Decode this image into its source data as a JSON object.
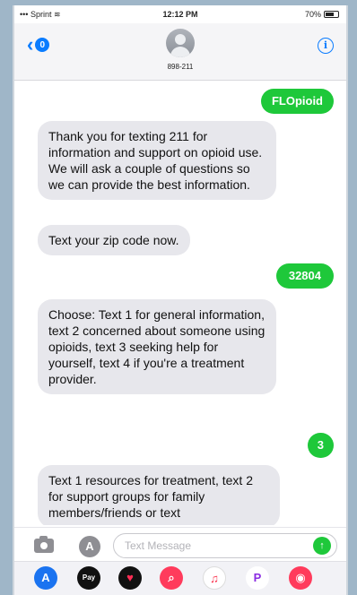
{
  "status_bar": {
    "carrier": "Sprint",
    "time": "12:12 PM",
    "battery_text": "70%",
    "battery_level": 0.7
  },
  "header": {
    "back_badge": "0",
    "contact_name": "898-211",
    "info_icon": "info-icon"
  },
  "messages": [
    {
      "direction": "sent",
      "text": "FLOpioid"
    },
    {
      "direction": "received",
      "text": "Thank you for texting 211 for information and support on opioid use. We will ask a couple of questions so we can provide the best information."
    },
    {
      "direction": "received",
      "text": "Text your zip code now."
    },
    {
      "direction": "sent",
      "text": "32804"
    },
    {
      "direction": "received",
      "text": "Choose: Text 1 for general information, text 2 concerned about someone using opioids, text 3 seeking help for yourself, text 4 if you're a treatment provider."
    },
    {
      "direction": "sent",
      "text": "3"
    },
    {
      "direction": "received",
      "text": "Text 1 resources for treatment, text 2 for support groups for family members/friends or text"
    }
  ],
  "composer": {
    "placeholder": "Text Message",
    "camera_icon": "camera-icon",
    "apps_icon": "app-store-icon",
    "send_icon": "send-arrow-icon"
  },
  "app_tray": {
    "apps": [
      "app-store-icon",
      "apple-pay-icon",
      "digital-touch-icon",
      "image-search-icon",
      "music-icon",
      "p-app-icon",
      "sticker-icon"
    ],
    "apple_pay_label": "Pay"
  },
  "colors": {
    "accent": "#0a7cff",
    "sent_bubble": "#1ec83a",
    "received_bubble": "#e7e7ec"
  }
}
